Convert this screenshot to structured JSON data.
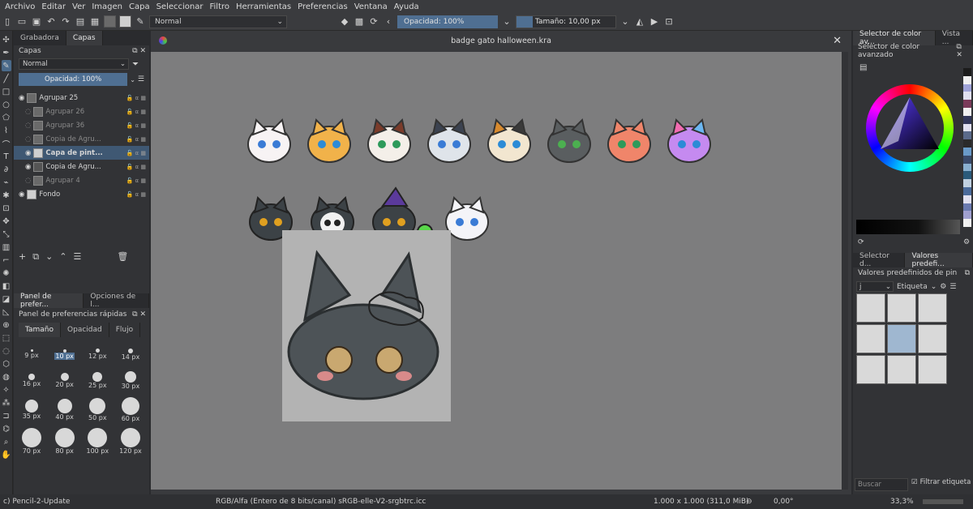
{
  "menu": [
    "Archivo",
    "Editar",
    "Ver",
    "Imagen",
    "Capa",
    "Seleccionar",
    "Filtro",
    "Herramientas",
    "Preferencias",
    "Ventana",
    "Ayuda"
  ],
  "toolbar": {
    "blend_mode": "Normal",
    "opacity_label": "Opacidad: 100%",
    "size_label": "Tamaño: 10,00 px"
  },
  "left_dock": {
    "tabs": [
      "Grabadora",
      "Capas"
    ],
    "layers_title": "Capas",
    "blend_mode": "Normal",
    "opacity_label": "Opacidad:  100%",
    "layers": [
      {
        "name": "Agrupar 25",
        "state": "normal"
      },
      {
        "name": "Agrupar 26",
        "state": "dim"
      },
      {
        "name": "Agrupar 36",
        "state": "dim"
      },
      {
        "name": "Copia de Agru...",
        "state": "dim"
      },
      {
        "name": "Capa de pint...",
        "state": "selected"
      },
      {
        "name": "Copia de Agru...",
        "state": "normal"
      },
      {
        "name": "Agrupar 4",
        "state": "dim"
      },
      {
        "name": "Fondo",
        "state": "normal"
      }
    ],
    "bottom_tabs": [
      "Panel de prefer...",
      "Opciones de l..."
    ],
    "quick_panel_title": "Panel de preferencias rápidas",
    "quick_tabs": [
      "Tamaño",
      "Opacidad",
      "Flujo"
    ],
    "sizes": [
      "9 px",
      "10 px",
      "12 px",
      "14 px",
      "16 px",
      "20 px",
      "25 px",
      "30 px",
      "35 px",
      "40 px",
      "50 px",
      "60 px",
      "70 px",
      "80 px",
      "100 px",
      "120 px"
    ]
  },
  "canvas": {
    "document_title": "badge gato halloween.kra"
  },
  "right_dock": {
    "tabs": [
      "Selector de color av...",
      "Vista ..."
    ],
    "color_title": "Selector de color avanzado",
    "bottom_tabs": [
      "Selector d...",
      "Valores predefi..."
    ],
    "presets_title": "Valores predefinidos de pin",
    "tag_label": "Etiqueta",
    "tag_value": "j",
    "search_placeholder": "Buscar",
    "filter_label": "Filtrar etiqueta"
  },
  "status": {
    "tool": "c) Pencil-2-Update",
    "color_space": "RGB/Alfa (Entero de 8 bits/canal)  sRGB-elle-V2-srgbtrc.icc",
    "dimensions": "1.000 x 1.000 (311,0 MiB)",
    "rotation": "0,00°",
    "zoom": "33,3%"
  },
  "colors": {
    "accent": "#4a6a8a",
    "canvas_bg": "#7d7d7e"
  }
}
